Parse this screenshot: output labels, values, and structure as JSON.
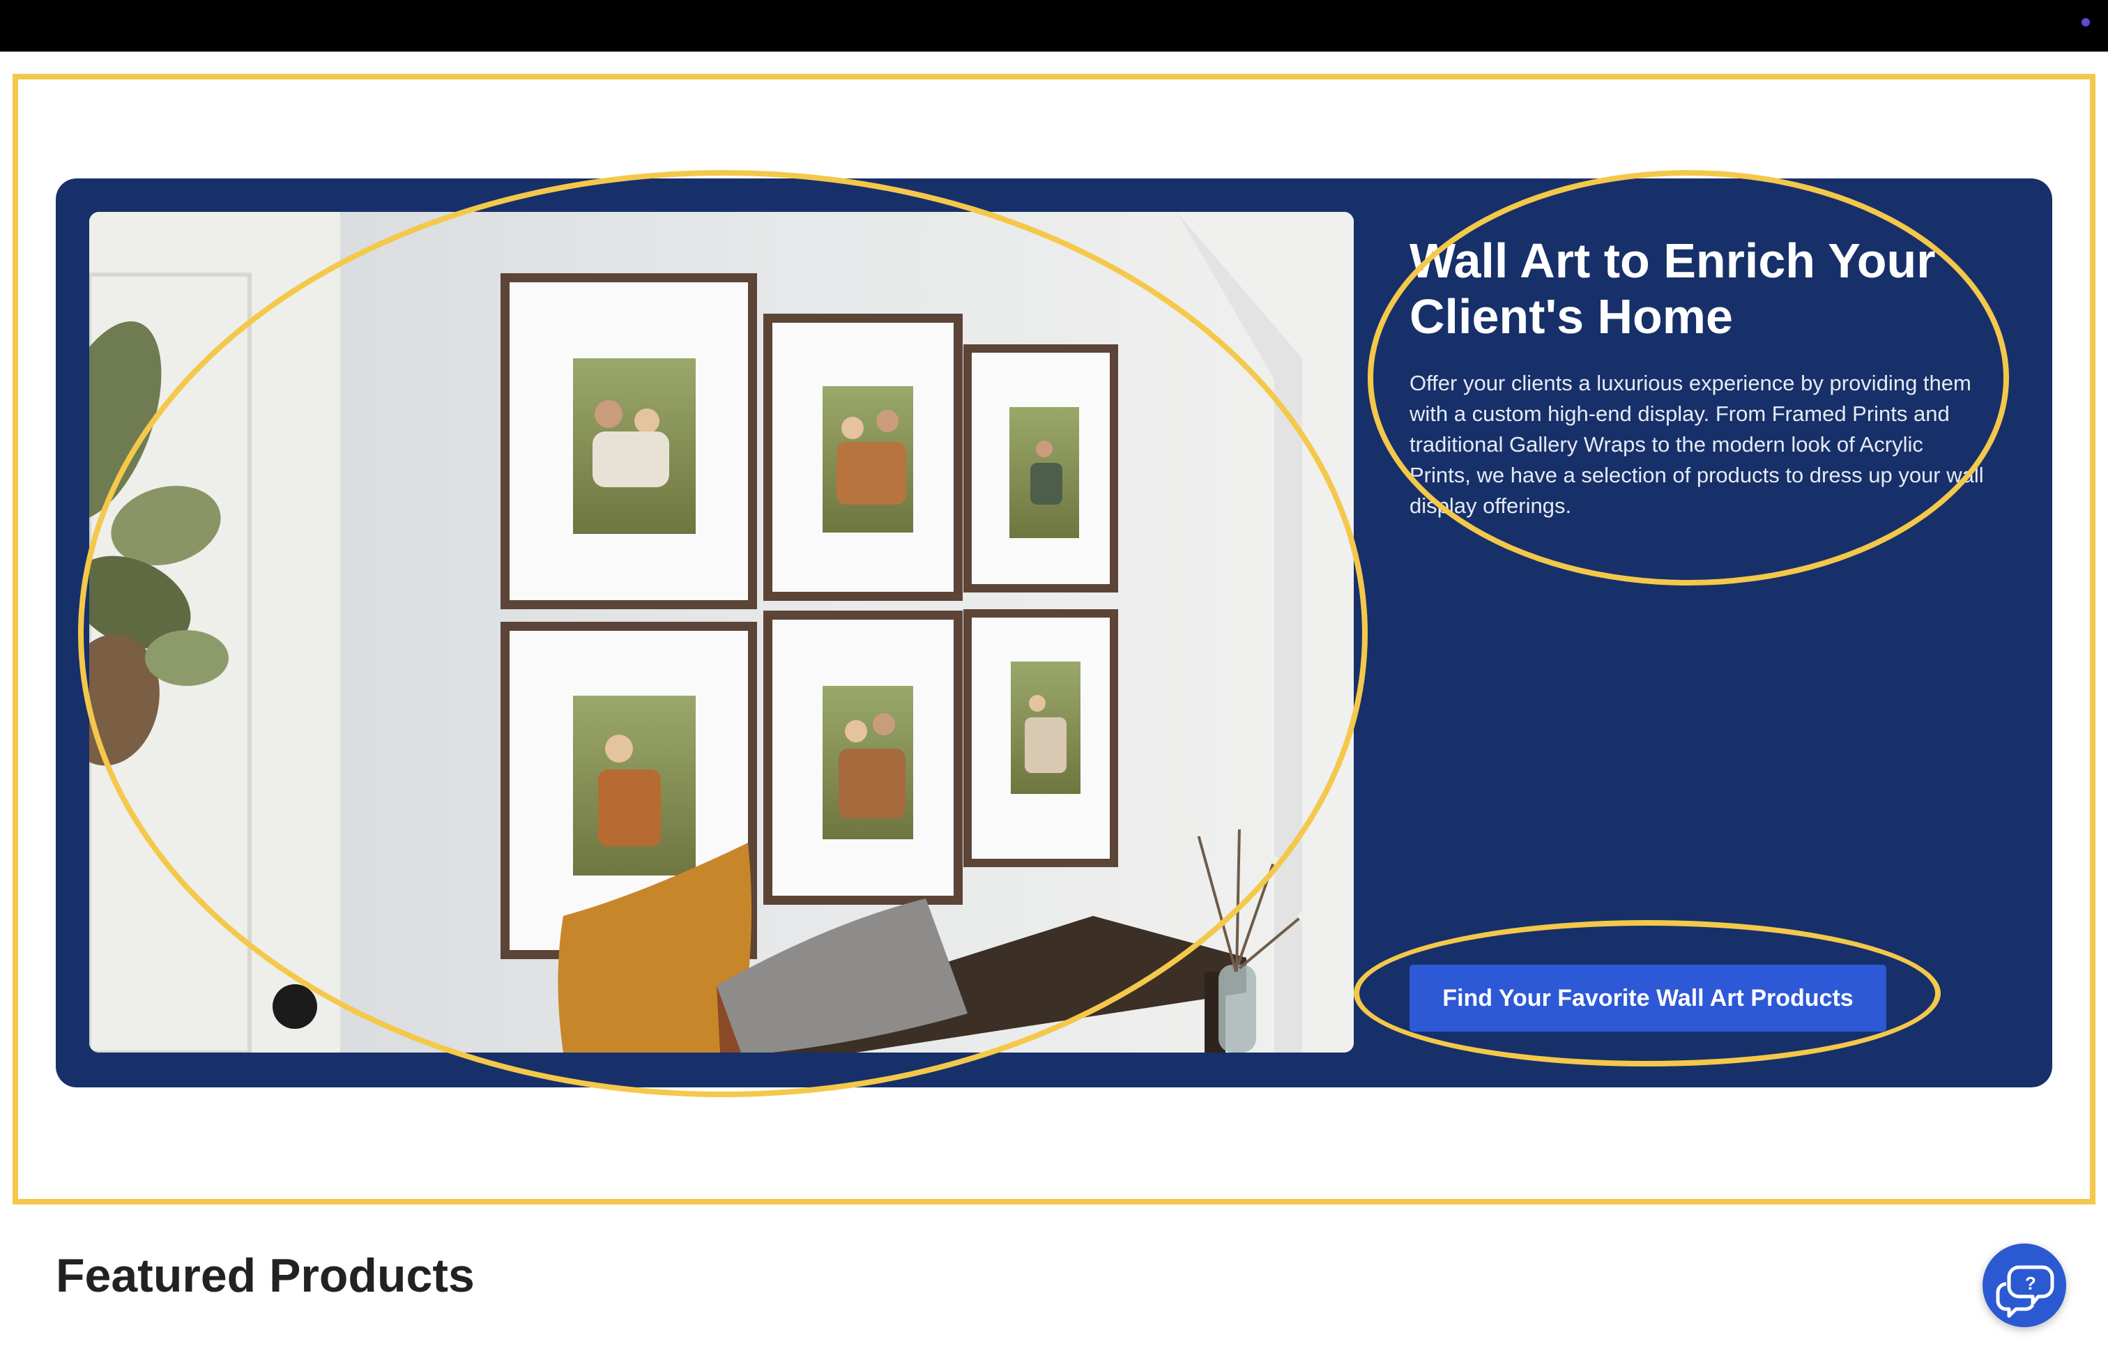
{
  "hero": {
    "title": "Wall Art to Enrich Your Client's Home",
    "description": "Offer your clients a luxurious experience by providing them with a custom high-end display. From Framed Prints and traditional Gallery Wraps to the modern look of Acrylic Prints, we have a selection of products to dress up your wall display offerings.",
    "cta_label": "Find Your Favorite Wall Art Products",
    "colors": {
      "panel": "#173069",
      "button": "#2d58d6",
      "annotation": "#f4c84a"
    }
  },
  "featured": {
    "title": "Featured Products"
  },
  "help": {
    "icon": "help-chat-icon"
  }
}
